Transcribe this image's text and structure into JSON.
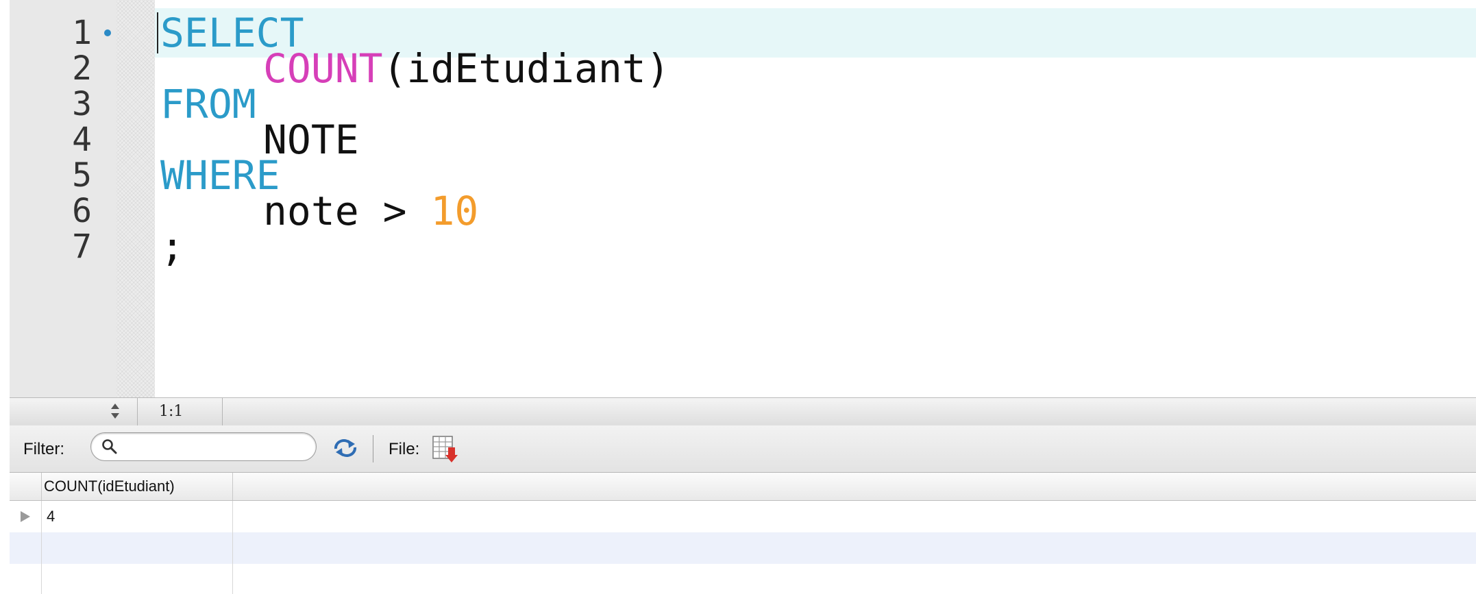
{
  "editor": {
    "lines": [
      {
        "number": "1",
        "tokens": [
          {
            "text": "SELECT",
            "kind": "keyword"
          }
        ]
      },
      {
        "number": "2",
        "tokens": [
          {
            "text": "COUNT",
            "kind": "function"
          },
          {
            "text": "(idEtudiant)",
            "kind": "plain"
          }
        ]
      },
      {
        "number": "3",
        "tokens": [
          {
            "text": "FROM",
            "kind": "keyword"
          }
        ]
      },
      {
        "number": "4",
        "tokens": [
          {
            "text": "NOTE",
            "kind": "plain"
          }
        ]
      },
      {
        "number": "5",
        "tokens": [
          {
            "text": "WHERE",
            "kind": "keyword"
          }
        ]
      },
      {
        "number": "6",
        "tokens": [
          {
            "text": "note > ",
            "kind": "plain"
          },
          {
            "text": "10",
            "kind": "number"
          }
        ]
      },
      {
        "number": "7",
        "tokens": [
          {
            "text": ";",
            "kind": "plain"
          }
        ]
      }
    ],
    "colors": {
      "keyword": "#2b9bc9",
      "function": "#d63fb8",
      "number": "#f39c2c",
      "plain": "#111111",
      "current_line": "#e6f7f8",
      "statement_marker": "#2a8ac6"
    }
  },
  "status_bar": {
    "cursor_position": "1:1"
  },
  "filter_bar": {
    "filter_label": "Filter:",
    "filter_value": "",
    "file_label": "File:",
    "icons": {
      "search": "search-icon",
      "refresh": "refresh-icon",
      "export": "export-file-icon"
    }
  },
  "results": {
    "columns": [
      "COUNT(idEtudiant)"
    ],
    "rows": [
      [
        "4"
      ]
    ],
    "alt_row_color": "#edf1fb"
  }
}
